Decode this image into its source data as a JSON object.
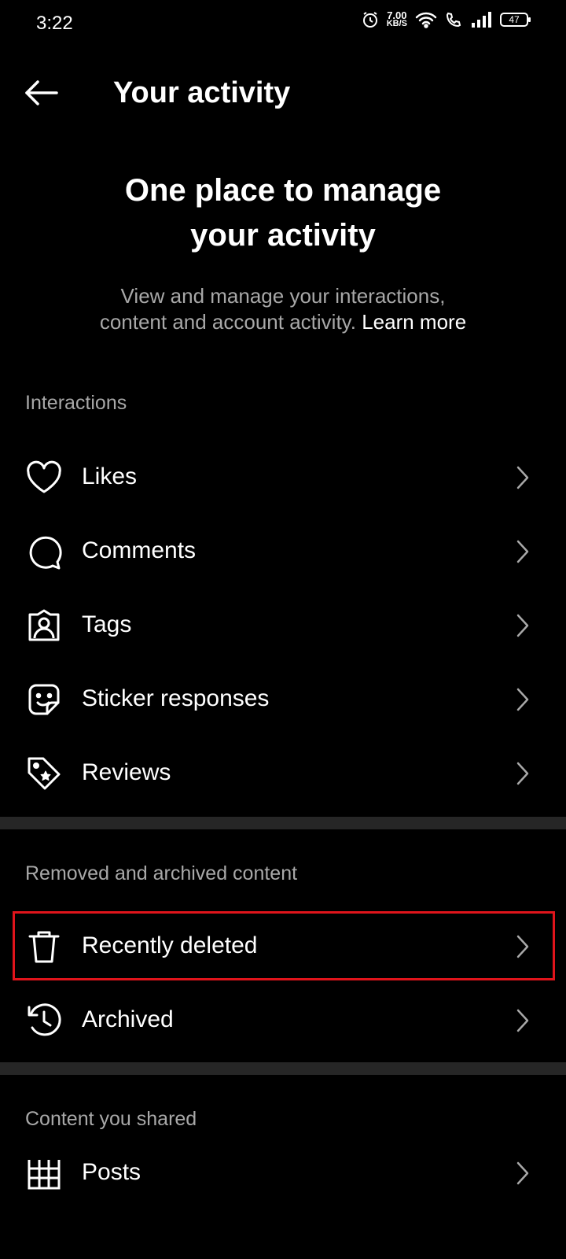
{
  "status_bar": {
    "time": "3:22",
    "net_speed_value": "7.00",
    "net_speed_unit": "KB/S",
    "battery": "47"
  },
  "header": {
    "title": "Your activity",
    "back_icon": "arrow-left-icon"
  },
  "hero": {
    "title_line1": "One place to manage",
    "title_line2": "your activity",
    "desc_line1": "View and manage your interactions,",
    "desc_line2": "content and account activity.",
    "learn_more": "Learn more"
  },
  "sections": {
    "interactions": {
      "label": "Interactions",
      "items": [
        {
          "label": "Likes",
          "icon": "heart-icon"
        },
        {
          "label": "Comments",
          "icon": "comment-icon"
        },
        {
          "label": "Tags",
          "icon": "tag-person-icon"
        },
        {
          "label": "Sticker responses",
          "icon": "sticker-icon"
        },
        {
          "label": "Reviews",
          "icon": "review-tag-icon"
        }
      ]
    },
    "removed": {
      "label": "Removed and archived content",
      "items": [
        {
          "label": "Recently deleted",
          "icon": "trash-icon",
          "highlighted": true
        },
        {
          "label": "Archived",
          "icon": "archive-clock-icon"
        }
      ]
    },
    "shared": {
      "label": "Content you shared",
      "items": [
        {
          "label": "Posts",
          "icon": "grid-icon"
        }
      ]
    }
  },
  "colors": {
    "background": "#000000",
    "secondary_text": "#a8a8a8",
    "divider": "#262626",
    "highlight": "#e0141b"
  }
}
